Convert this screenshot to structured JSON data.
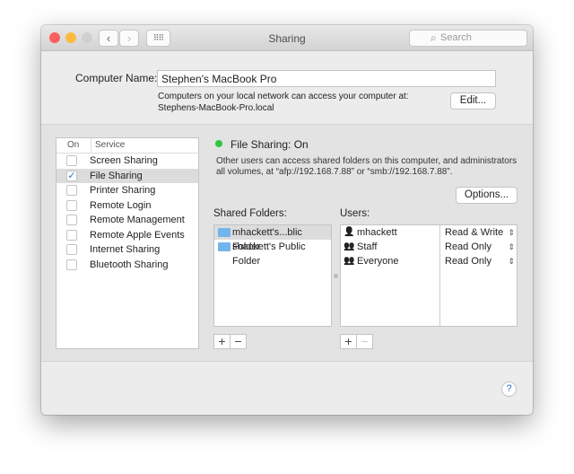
{
  "window": {
    "title": "Sharing",
    "search_placeholder": "Search"
  },
  "computer_name": {
    "label": "Computer Name:",
    "value": "Stephen's MacBook Pro",
    "info_line1": "Computers on your local network can access your computer at:",
    "info_line2": "Stephens-MacBook-Pro.local",
    "edit_label": "Edit..."
  },
  "services": {
    "col_on": "On",
    "col_service": "Service",
    "items": [
      {
        "label": "Screen Sharing",
        "on": false
      },
      {
        "label": "File Sharing",
        "on": true,
        "selected": true
      },
      {
        "label": "Printer Sharing",
        "on": false
      },
      {
        "label": "Remote Login",
        "on": false
      },
      {
        "label": "Remote Management",
        "on": false
      },
      {
        "label": "Remote Apple Events",
        "on": false
      },
      {
        "label": "Internet Sharing",
        "on": false
      },
      {
        "label": "Bluetooth Sharing",
        "on": false
      }
    ]
  },
  "detail": {
    "status": "File Sharing: On",
    "status_color": "#2ec840",
    "description_line1": "Other users can access shared folders on this computer, and administrators",
    "description_line2": "all volumes, at “afp://192.168.7.88” or “smb://192.168.7.88”.",
    "options_label": "Options...",
    "shared_folders_label": "Shared Folders:",
    "folders": [
      "mhackett's...blic Folder",
      "shackett's Public Folder"
    ],
    "users_label": "Users:",
    "users": [
      {
        "name": "mhackett",
        "permission": "Read & Write"
      },
      {
        "name": "Staff",
        "permission": "Read Only"
      },
      {
        "name": "Everyone",
        "permission": "Read Only"
      }
    ]
  },
  "help": "?"
}
